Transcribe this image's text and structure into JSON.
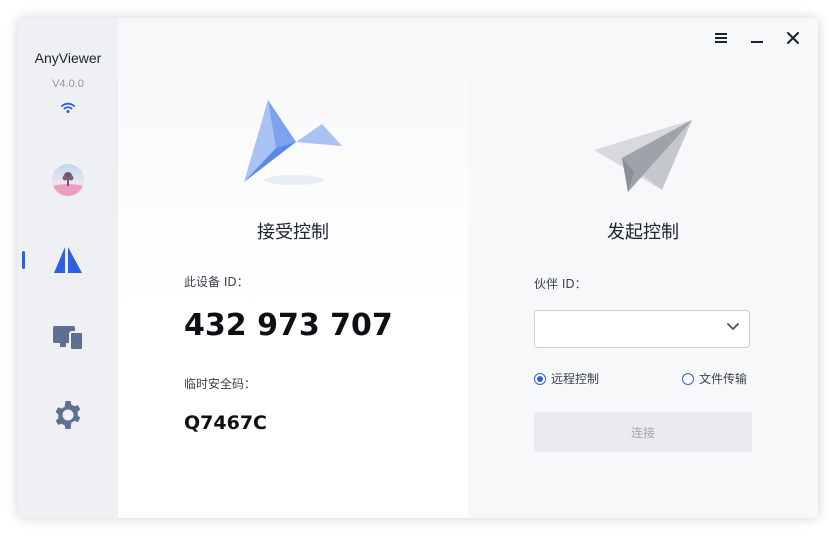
{
  "app": {
    "name": "AnyViewer",
    "version": "V4.0.0"
  },
  "sidebar": {
    "items": [
      {
        "name": "avatar",
        "icon": "avatar-icon"
      },
      {
        "name": "remote-control",
        "icon": "anyviewer-logo-icon",
        "active": true
      },
      {
        "name": "devices",
        "icon": "devices-icon"
      },
      {
        "name": "settings",
        "icon": "gear-icon"
      }
    ]
  },
  "window_controls": {
    "menu": "menu-icon",
    "minimize": "minimize-icon",
    "close": "close-icon"
  },
  "receive_panel": {
    "title": "接受控制",
    "device_id_label": "此设备 ID：",
    "device_id": "432 973 707",
    "temp_code_label": "临时安全码：",
    "temp_code": "Q7467C"
  },
  "control_panel": {
    "title": "发起控制",
    "partner_id_label": "伙伴 ID：",
    "partner_id_value": "",
    "options": [
      {
        "label": "远程控制",
        "selected": true
      },
      {
        "label": "文件传输",
        "selected": false
      }
    ],
    "connect_label": "连接"
  },
  "colors": {
    "accent": "#2f5fe0",
    "sidebar_bg": "#eef0f4",
    "disabled_button": "#e8eaee"
  }
}
